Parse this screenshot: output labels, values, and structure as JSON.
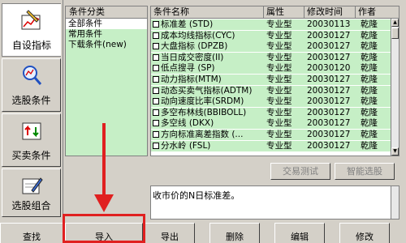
{
  "sidebar": {
    "items": [
      {
        "label": "自设指标",
        "icon": "pen-chart-icon",
        "active": true
      },
      {
        "label": "选股条件",
        "icon": "magnifier-chart-icon",
        "active": false
      },
      {
        "label": "买卖条件",
        "icon": "arrows-chart-icon",
        "active": false
      },
      {
        "label": "选股组合",
        "icon": "pencil-chart-icon",
        "active": false
      }
    ]
  },
  "categories": {
    "header": "条件分类",
    "items": [
      "全部条件",
      "常用条件",
      "下载条件(new)"
    ]
  },
  "list": {
    "columns": [
      "条件名称",
      "属性",
      "修改时间",
      "作者"
    ],
    "rows": [
      {
        "name": "标准差 (STD)",
        "prop": "专业型",
        "date": "20030113",
        "author": "乾隆"
      },
      {
        "name": "成本均线指标(CYC)",
        "prop": "专业型",
        "date": "20030127",
        "author": "乾隆"
      },
      {
        "name": "大盘指标 (DPZB)",
        "prop": "专业型",
        "date": "20030127",
        "author": "乾隆"
      },
      {
        "name": "当日成交密度(II)",
        "prop": "专业型",
        "date": "20030127",
        "author": "乾隆"
      },
      {
        "name": "低点搜寻 (SP)",
        "prop": "专业型",
        "date": "20030120",
        "author": "乾隆"
      },
      {
        "name": "动力指标(MTM)",
        "prop": "专业型",
        "date": "20030127",
        "author": "乾隆"
      },
      {
        "name": "动态买卖气指标(ADTM)",
        "prop": "专业型",
        "date": "20030127",
        "author": "乾隆"
      },
      {
        "name": "动向速度比率(SRDM)",
        "prop": "专业型",
        "date": "20030127",
        "author": "乾隆"
      },
      {
        "name": "多空布林线(BBIBOLL)",
        "prop": "专业型",
        "date": "20030127",
        "author": "乾隆"
      },
      {
        "name": "多空线 (DKX)",
        "prop": "专业型",
        "date": "20030127",
        "author": "乾隆"
      },
      {
        "name": "方向标准离差指数 (...",
        "prop": "专业型",
        "date": "20030127",
        "author": "乾隆"
      },
      {
        "name": "分水岭 (FSL)",
        "prop": "专业型",
        "date": "20030127",
        "author": "乾隆"
      }
    ]
  },
  "actions": {
    "trade_test": "交易测试",
    "smart_select": "智能选股"
  },
  "description": "收市价的N日标准差。",
  "bottom_buttons": [
    "查找",
    "导入",
    "导出",
    "删除",
    "编辑",
    "修改"
  ],
  "colors": {
    "list_background": "#c6efc6",
    "window": "#d4d0c8",
    "annotation": "#e02020"
  }
}
